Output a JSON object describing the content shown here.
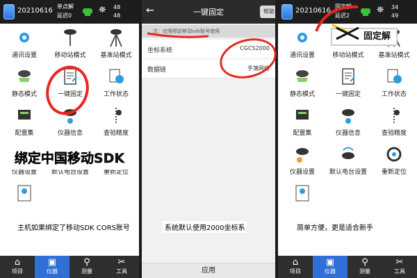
{
  "left": {
    "status": {
      "date": "20210616",
      "line1": "单点解",
      "line2": "延迟0",
      "num_top": "48",
      "num_bottom": "48"
    },
    "grid": [
      {
        "label": "通讯设置",
        "icon": "settings-gear-icon"
      },
      {
        "label": "移动站模式",
        "icon": "rover-antenna-icon"
      },
      {
        "label": "基准站模式",
        "icon": "base-tripod-icon"
      },
      {
        "label": "静态模式",
        "icon": "static-receiver-icon"
      },
      {
        "label": "一键固定",
        "icon": "document-edit-icon"
      },
      {
        "label": "工作状态",
        "icon": "clock-status-icon"
      },
      {
        "label": "配置集",
        "icon": "config-set-icon"
      },
      {
        "label": "仪器信息",
        "icon": "device-info-icon"
      },
      {
        "label": "查验精度",
        "icon": "precision-check-icon"
      },
      {
        "label": "仪器设置",
        "icon": "device-settings-icon"
      },
      {
        "label": "默认电台设置",
        "icon": "radio-tower-icon"
      },
      {
        "label": "重新定位",
        "icon": "relocate-icon"
      },
      {
        "label": "",
        "icon": "user-badge-icon"
      }
    ],
    "banner": "绑定中国移动SDK",
    "caption": "主机如果绑定了移动SDK CORS账号"
  },
  "middle": {
    "title": "一键固定",
    "help": "帮助",
    "note": "注：仅限绑定移动sdk账号使用",
    "rows": [
      {
        "key": "坐标系统",
        "value": "CGCS2000"
      },
      {
        "key": "数据链",
        "value": "手簿网络"
      }
    ],
    "caption": "系统默认使用2000坐标系",
    "apply": "应用"
  },
  "right": {
    "status": {
      "date": "20210616",
      "line1": "固定解",
      "line2": "延迟2",
      "num_top": "34",
      "num_bottom": "49"
    },
    "toast": "固定解",
    "caption": "简单方便，更是适合新手"
  },
  "tabs": [
    {
      "label": "项目",
      "icon": "home-icon"
    },
    {
      "label": "仪器",
      "icon": "instrument-icon"
    },
    {
      "label": "测量",
      "icon": "location-pin-icon"
    },
    {
      "label": "工具",
      "icon": "tools-icon"
    }
  ],
  "colors": {
    "annotation_red": "#e8261f",
    "tab_active": "#2f6fd6",
    "status_bar": "#1d1d1d"
  }
}
